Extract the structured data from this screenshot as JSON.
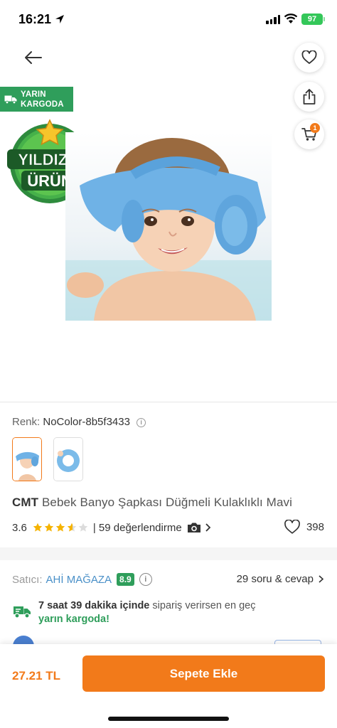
{
  "status_bar": {
    "time": "16:21",
    "battery": "97"
  },
  "badges": {
    "cargo_line1": "YARIN",
    "cargo_line2": "KARGODA",
    "star_line1": "YILDIZLI",
    "star_line2": "ÜRÜN"
  },
  "cart": {
    "count": "1"
  },
  "variant": {
    "label": "Renk:",
    "value": "NoColor-8b5f3433",
    "info": "i"
  },
  "product": {
    "brand": "CMT",
    "name": "Bebek Banyo Şapkası Düğmeli Kulaklıklı Mavi",
    "rating": "3.6",
    "rating_value": 3.6,
    "rating_max": 5,
    "reviews": "| 59 değerlendirme",
    "favorites": "398"
  },
  "seller": {
    "label": "Satıcı:",
    "name": "AHİ MAĞAZA",
    "score": "8.9",
    "info": "i",
    "qa": "29 soru & cevap"
  },
  "delivery": {
    "bold": "7 saat 39 dakika içinde",
    "rest": "sipariş verirsen en geç",
    "highlight": "yarın kargoda!"
  },
  "footer": {
    "price": "27.21 TL",
    "button": "Sepete Ekle"
  },
  "colors": {
    "accent": "#f27a1a",
    "green": "#2f9e5b",
    "link": "#4a90c8"
  },
  "icons": [
    "location-arrow-icon",
    "signal-icon",
    "wifi-icon",
    "battery-icon",
    "back-arrow-icon",
    "heart-icon",
    "share-icon",
    "cart-icon",
    "truck-icon",
    "star-icon",
    "info-icon",
    "camera-icon",
    "chevron-right-icon"
  ]
}
